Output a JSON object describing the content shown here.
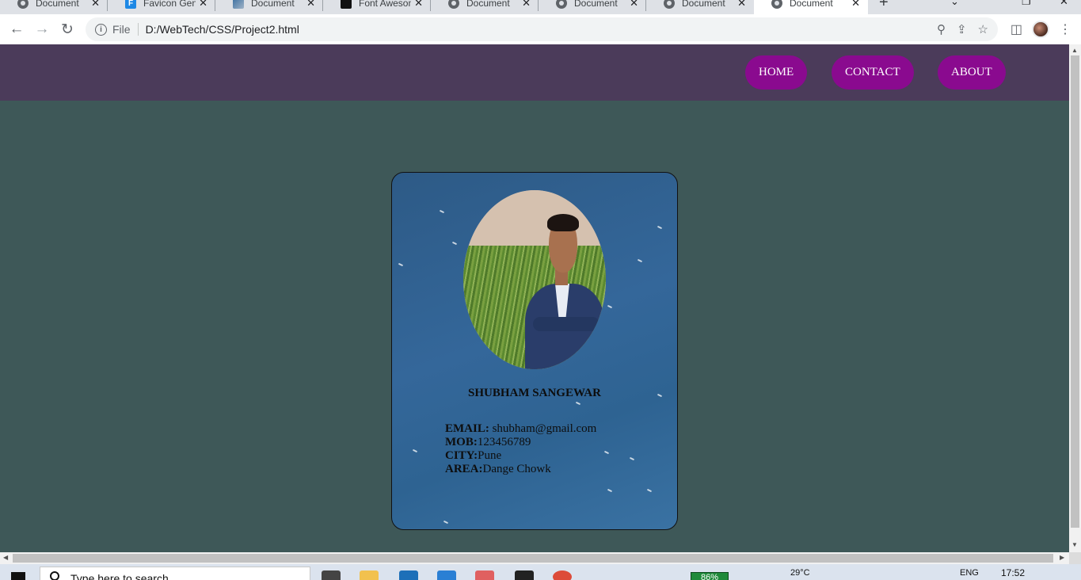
{
  "browser": {
    "tabs": [
      {
        "title": "Document",
        "favicon": "globe-icon"
      },
      {
        "title": "Favicon Gene",
        "favicon": "favicon-f-icon"
      },
      {
        "title": "Document",
        "favicon": "image-icon"
      },
      {
        "title": "Font Awesom",
        "favicon": "font-awesome-icon"
      },
      {
        "title": "Document",
        "favicon": "globe-icon"
      },
      {
        "title": "Document",
        "favicon": "globe-icon"
      },
      {
        "title": "Document",
        "favicon": "globe-icon"
      },
      {
        "title": "Document",
        "favicon": "globe-icon",
        "active": true
      }
    ],
    "address": {
      "scheme_label": "File",
      "url": "D:/WebTech/CSS/Project2.html"
    }
  },
  "page": {
    "nav": {
      "home": "HOME",
      "contact": "CONTACT",
      "about": "ABOUT"
    },
    "nav_color": "#8a0a8f",
    "header_color": "#4b3b5a",
    "background_color": "#3e5858",
    "card": {
      "name": "SHUBHAM SANGEWAR",
      "email_label": "EMAIL:",
      "email_value": " shubham@gmail.com",
      "mob_label": "MOB:",
      "mob_value": "123456789",
      "city_label": "CITY:",
      "city_value": "Pune",
      "area_label": "AREA:",
      "area_value": "Dange Chowk"
    }
  },
  "taskbar": {
    "search_placeholder": "Type here to search",
    "battery": "86%",
    "temperature": "29°C",
    "language": "ENG",
    "time": "17:52"
  }
}
